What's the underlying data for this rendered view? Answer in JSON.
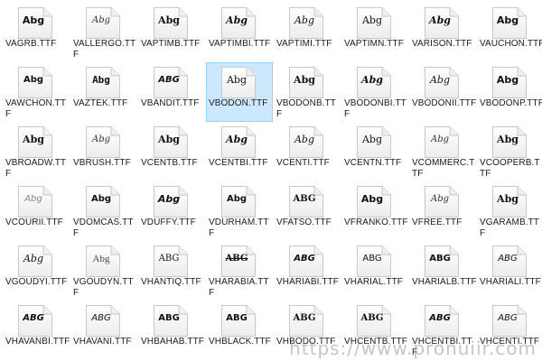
{
  "colors": {
    "selected_bg": "#cce8ff",
    "selected_border": "#99d1ff"
  },
  "icon": "font-file-icon",
  "watermark": "https://www.pronuiir.com",
  "files": [
    {
      "name": "VAGRB.TTF",
      "preview": "Abg",
      "style": "bold"
    },
    {
      "name": "VALLERGO.TTF",
      "preview": "Abg",
      "style": "script"
    },
    {
      "name": "VAPTIMB.TTF",
      "preview": "Abg",
      "style": "serifb"
    },
    {
      "name": "VAPTIMBI.TTF",
      "preview": "Abg",
      "style": "serifbi"
    },
    {
      "name": "VAPTIMI.TTF",
      "preview": "Abg",
      "style": "serifi"
    },
    {
      "name": "VAPTIMN.TTF",
      "preview": "Abg",
      "style": "serif"
    },
    {
      "name": "VARISON.TTF",
      "preview": "Abg",
      "style": "serifbi"
    },
    {
      "name": "VAUCHON.TTF",
      "preview": "Abg",
      "style": "bold"
    },
    {
      "name": "VAWCHON.TTF",
      "preview": "Abg",
      "style": "heavy"
    },
    {
      "name": "VAZTEK.TTF",
      "preview": "Abg",
      "style": "rough"
    },
    {
      "name": "VBANDIT.TTF",
      "preview": "ABG",
      "style": "capsbi"
    },
    {
      "name": "VBODON.TTF",
      "preview": "Abg",
      "style": "serif",
      "selected": true
    },
    {
      "name": "VBODONB.TTF",
      "preview": "Abg",
      "style": "serifb"
    },
    {
      "name": "VBODONBI.TTF",
      "preview": "Abg",
      "style": "serifbi"
    },
    {
      "name": "VBODONII.TTF",
      "preview": "Abg",
      "style": "serifi"
    },
    {
      "name": "VBODONP.TTF",
      "preview": "Abg",
      "style": "bold"
    },
    {
      "name": "VBROADW.TTF",
      "preview": "Abg",
      "style": "serifb"
    },
    {
      "name": "VBRUSH.TTF",
      "preview": "Abg",
      "style": "script"
    },
    {
      "name": "VCENTB.TTF",
      "preview": "Abg",
      "style": "serifb"
    },
    {
      "name": "VCENTBI.TTF",
      "preview": "Abg",
      "style": "serifbi"
    },
    {
      "name": "VCENTI.TTF",
      "preview": "Abg",
      "style": "serifi"
    },
    {
      "name": "VCENTN.TTF",
      "preview": "Abg",
      "style": "serif"
    },
    {
      "name": "VCOMMERC.TTF",
      "preview": "Abg",
      "style": "script"
    },
    {
      "name": "VCOOPERB.TTF",
      "preview": "Abg",
      "style": "serifb"
    },
    {
      "name": "VCOURII.TTF",
      "preview": "Abg",
      "style": "light"
    },
    {
      "name": "VDOMCAS.TTF",
      "preview": "Abg",
      "style": "heavy"
    },
    {
      "name": "VDUFFY.TTF",
      "preview": "Abg",
      "style": "bolditalic"
    },
    {
      "name": "VDURHAM.TTF",
      "preview": "Abg",
      "style": "heavy"
    },
    {
      "name": "VFATSO.TTF",
      "preview": "ABG",
      "style": "caps-serifb"
    },
    {
      "name": "VFRANKO.TTF",
      "preview": "Abg",
      "style": "bold"
    },
    {
      "name": "VFREE.TTF",
      "preview": "Abg",
      "style": "script"
    },
    {
      "name": "VGARAMB.TTF",
      "preview": "Abg",
      "style": "serifb"
    },
    {
      "name": "VGOUDYI.TTF",
      "preview": "Abg",
      "style": "serifi"
    },
    {
      "name": "VGOUDYN.TTF",
      "preview": "Abg",
      "style": "serifl"
    },
    {
      "name": "VHANTIQ.TTF",
      "preview": "ABG",
      "style": "caps-serif"
    },
    {
      "name": "VHARABIA.TTF",
      "preview": "ABG",
      "style": "caps-strike"
    },
    {
      "name": "VHARIABI.TTF",
      "preview": "ABG",
      "style": "capsbi"
    },
    {
      "name": "VHARIAL.TTF",
      "preview": "ABG",
      "style": "capsn"
    },
    {
      "name": "VHARIALB.TTF",
      "preview": "ABG",
      "style": "capsb"
    },
    {
      "name": "VHARIALI.TTF",
      "preview": "ABG",
      "style": "capsi"
    },
    {
      "name": "VHAVANBI.TTF",
      "preview": "ABG",
      "style": "capsbi"
    },
    {
      "name": "VHAVANI.TTF",
      "preview": "ABG",
      "style": "capsi"
    },
    {
      "name": "VHBAHAB.TTF",
      "preview": "ABG",
      "style": "capsb"
    },
    {
      "name": "VHBLACK.TTF",
      "preview": "ABG",
      "style": "capsb"
    },
    {
      "name": "VHBODO.TTF",
      "preview": "ABG",
      "style": "caps-serifb"
    },
    {
      "name": "VHCENTB.TTF",
      "preview": "ABG",
      "style": "caps-serifb"
    },
    {
      "name": "VHCENTBI.TTF",
      "preview": "ABG",
      "style": "capsbi"
    },
    {
      "name": "VHCENTI.TTF",
      "preview": "ABG",
      "style": "capsi"
    }
  ]
}
